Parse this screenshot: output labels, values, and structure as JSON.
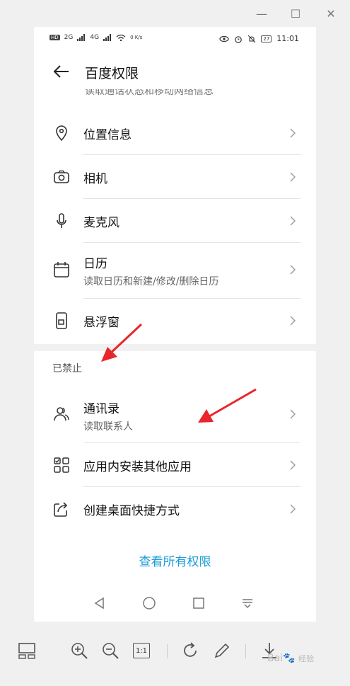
{
  "window": {
    "minimize": "—",
    "maximize": "☐",
    "close": "✕"
  },
  "statusbar": {
    "left": [
      "HD",
      "2G",
      "4G",
      "0 K/s"
    ],
    "battery": "27",
    "time": "11:01"
  },
  "page_title": "百度权限",
  "cutoff_text": "读取通话状态和移动网络信息",
  "allowed": [
    {
      "label": "位置信息",
      "sub": "",
      "icon": "location-icon"
    },
    {
      "label": "相机",
      "sub": "",
      "icon": "camera-icon"
    },
    {
      "label": "麦克风",
      "sub": "",
      "icon": "microphone-icon"
    },
    {
      "label": "日历",
      "sub": "读取日历和新建/修改/删除日历",
      "icon": "calendar-icon"
    },
    {
      "label": "悬浮窗",
      "sub": "",
      "icon": "floating-window-icon"
    }
  ],
  "denied_section_label": "已禁止",
  "denied": [
    {
      "label": "通讯录",
      "sub": "读取联系人",
      "icon": "contacts-icon"
    },
    {
      "label": "应用内安装其他应用",
      "sub": "",
      "icon": "apps-icon"
    },
    {
      "label": "创建桌面快捷方式",
      "sub": "",
      "icon": "shortcut-icon"
    }
  ],
  "view_all": "查看所有权限",
  "toolbar": {
    "one_to_one": "1:1"
  },
  "watermark": {
    "main": "Bai",
    "tail": "经验"
  },
  "colors": {
    "accent": "#1a9bd7",
    "arrow": "#e8262b"
  }
}
